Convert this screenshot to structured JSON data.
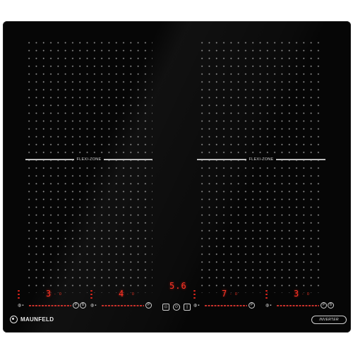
{
  "product": {
    "brand": "MAUNFELD",
    "inverter_badge": "INVERTER",
    "flexi_label": "FLEXI-ZONE"
  },
  "zones": [
    {
      "id": "front-left",
      "power": "3",
      "timer": "- 0"
    },
    {
      "id": "rear-left",
      "power": "4",
      "timer": "- 0"
    },
    {
      "id": "front-right",
      "power": "7",
      "timer": "- 0"
    },
    {
      "id": "rear-right",
      "power": "3",
      "timer": "- 0"
    }
  ],
  "center_display": {
    "value": "5.6",
    "buttons": [
      "lock",
      "power",
      "pause"
    ]
  },
  "zone_buttons": {
    "pause_symbol": "P",
    "boost_symbol": "B"
  },
  "icon_symbols": {
    "lock": "⊡",
    "power": "⏻",
    "pause": "▯"
  },
  "colors": {
    "panel": "#060606",
    "display_red": "#ff3324",
    "dot_grey": "#8d8d8d"
  }
}
